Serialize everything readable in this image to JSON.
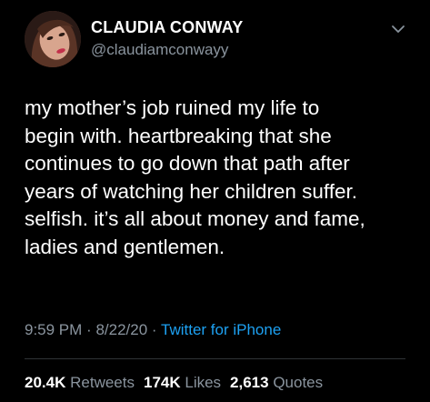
{
  "author": {
    "name": "CLAUDIA CONWAY",
    "handle": "@claudiamconwayy"
  },
  "tweet": {
    "text": "my mother’s job ruined my life to\nbegin with. heartbreaking that she\ncontinues to go down that path after\nyears of watching her children suffer.\nselfish. it’s all about money and fame,\nladies and gentlemen.",
    "time": "9:59 PM",
    "separator": "·",
    "date": "8/22/20",
    "source": "Twitter for iPhone"
  },
  "stats": {
    "retweets_count": "20.4K",
    "retweets_label": "Retweets",
    "likes_count": "174K",
    "likes_label": "Likes",
    "quotes_count": "2,613",
    "quotes_label": "Quotes"
  },
  "icons": {
    "more": "chevron-down-icon"
  },
  "colors": {
    "background": "#000000",
    "primary_text": "#ffffff",
    "secondary_text": "#8a949e",
    "link": "#1da1f2"
  }
}
